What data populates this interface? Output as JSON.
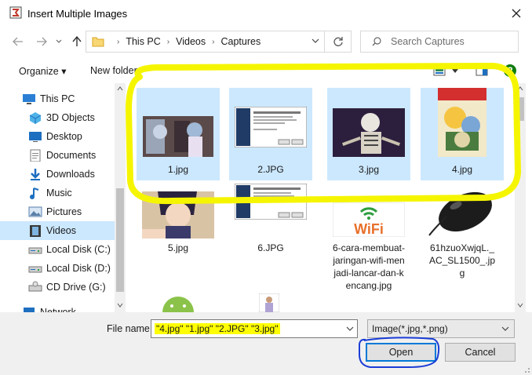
{
  "window": {
    "title": "Insert Multiple Images"
  },
  "address": {
    "crumbs": [
      "This PC",
      "Videos",
      "Captures"
    ]
  },
  "search": {
    "placeholder": "Search Captures"
  },
  "commands": {
    "organize": "Organize ▾",
    "new_folder": "New folder"
  },
  "sidebar": {
    "items": [
      {
        "label": "This PC",
        "icon": "computer-icon"
      },
      {
        "label": "3D Objects",
        "icon": "cube-icon"
      },
      {
        "label": "Desktop",
        "icon": "desktop-icon"
      },
      {
        "label": "Documents",
        "icon": "documents-icon"
      },
      {
        "label": "Downloads",
        "icon": "download-icon"
      },
      {
        "label": "Music",
        "icon": "music-icon"
      },
      {
        "label": "Pictures",
        "icon": "pictures-icon"
      },
      {
        "label": "Videos",
        "icon": "videos-icon"
      },
      {
        "label": "Local Disk (C:)",
        "icon": "drive-icon"
      },
      {
        "label": "Local Disk (D:)",
        "icon": "drive-icon"
      },
      {
        "label": "CD Drive (G:)",
        "icon": "cd-drive-icon"
      },
      {
        "label": "Network",
        "icon": "network-icon"
      }
    ]
  },
  "files": [
    {
      "name": "1.jpg",
      "selected": true,
      "icon": "image-thumbnail-icon"
    },
    {
      "name": "2.JPG",
      "selected": true,
      "icon": "image-thumbnail-icon"
    },
    {
      "name": "3.jpg",
      "selected": true,
      "icon": "image-thumbnail-icon"
    },
    {
      "name": "4.jpg",
      "selected": true,
      "icon": "image-thumbnail-icon"
    },
    {
      "name": "5.jpg",
      "selected": false,
      "icon": "image-thumbnail-icon"
    },
    {
      "name": "6.JPG",
      "selected": false,
      "icon": "image-thumbnail-icon"
    },
    {
      "name": "6-cara-membuat-jaringan-wifi-menjadi-lancar-dan-kencang.jpg",
      "selected": false,
      "icon": "image-thumbnail-icon"
    },
    {
      "name": "61hzuoXwjqL._AC_SL1500_.jpg",
      "selected": false,
      "icon": "image-thumbnail-icon"
    }
  ],
  "footer": {
    "file_name_label": "File name:",
    "file_name_value": "\"4.jpg\" \"1.jpg\" \"2.JPG\" \"3.jpg\"",
    "file_type_value": "Image(*.jpg,*.png)",
    "open_label": "Open",
    "cancel_label": "Cancel"
  },
  "colors": {
    "selection": "#cce8ff",
    "highlight_yellow": "#ffff00",
    "highlight_blue": "#1a3cd6",
    "accent": "#0078d7"
  }
}
